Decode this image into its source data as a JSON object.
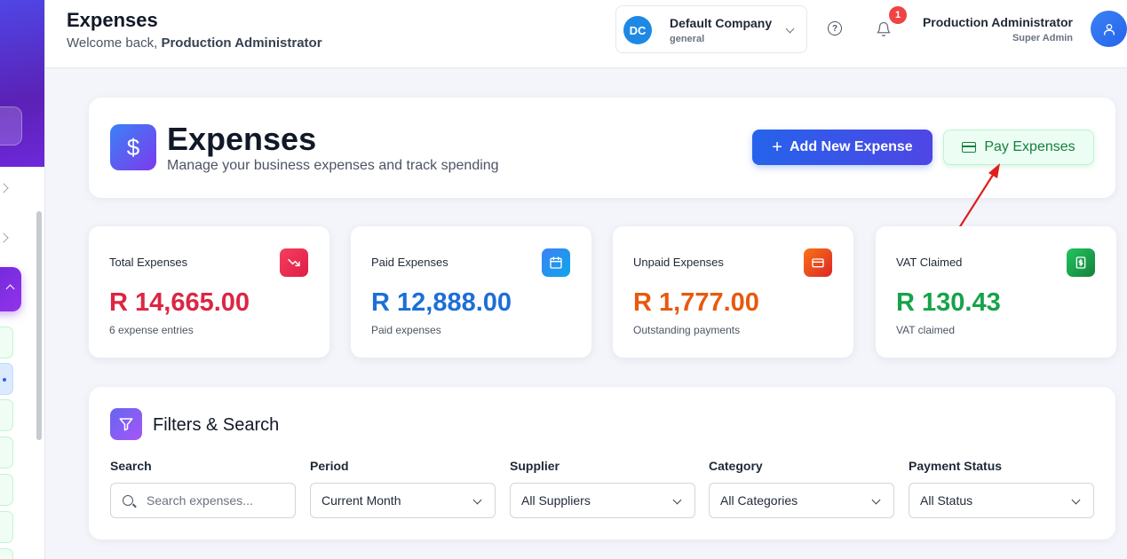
{
  "topbar": {
    "title": "Expenses",
    "welcome_prefix": "Welcome back, ",
    "welcome_name": "Production Administrator",
    "company": {
      "initials": "DC",
      "name": "Default Company",
      "sub": "general"
    },
    "notifications_count": "1",
    "user": {
      "name": "Production Administrator",
      "role": "Super Admin"
    }
  },
  "header": {
    "title": "Expenses",
    "subtitle": "Manage your business expenses and track spending",
    "add_button": "Add New Expense",
    "pay_button": "Pay Expenses"
  },
  "stats": [
    {
      "label": "Total Expenses",
      "value": "R 14,665.00",
      "sub": "6 expense entries",
      "color": "#dc2644",
      "icon": "trending-down-icon"
    },
    {
      "label": "Paid Expenses",
      "value": "R 12,888.00",
      "sub": "Paid expenses",
      "color": "#1d6fd6",
      "icon": "calendar-icon"
    },
    {
      "label": "Unpaid Expenses",
      "value": "R 1,777.00",
      "sub": "Outstanding payments",
      "color": "#e8590c",
      "icon": "credit-card-icon"
    },
    {
      "label": "VAT Claimed",
      "value": "R 130.43",
      "sub": "VAT claimed",
      "color": "#16a34a",
      "icon": "receipt-dollar-icon"
    }
  ],
  "filters": {
    "title": "Filters & Search",
    "search": {
      "label": "Search",
      "placeholder": "Search expenses..."
    },
    "period": {
      "label": "Period",
      "value": "Current Month"
    },
    "supplier": {
      "label": "Supplier",
      "value": "All Suppliers"
    },
    "category": {
      "label": "Category",
      "value": "All Categories"
    },
    "payment_status": {
      "label": "Payment Status",
      "value": "All Status"
    }
  },
  "colors": {
    "accent": "#2563eb",
    "sidebar": "#5b21b6",
    "pay_green": "#15803d",
    "annotation": "#e11d1d"
  }
}
